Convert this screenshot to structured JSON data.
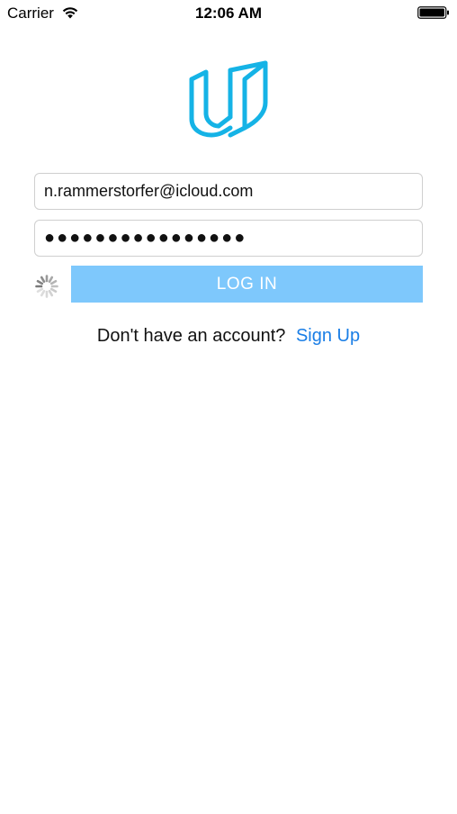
{
  "status_bar": {
    "carrier": "Carrier",
    "time": "12:06 AM",
    "wifi_icon": "wifi-icon",
    "battery_icon": "battery-icon"
  },
  "logo": {
    "icon": "udacity-logo-icon",
    "color": "#15b3e6"
  },
  "login_form": {
    "email_value": "n.rammerstorfer@icloud.com",
    "password_value": "●●●●●●●●●●●●●●●●",
    "activity_indicator": "spinner-icon",
    "login_label": "LOG IN",
    "login_button_color": "#7ec8fc"
  },
  "signup": {
    "prompt": "Don't have an account?",
    "link_label": "Sign Up",
    "link_color": "#1a7ee6"
  }
}
